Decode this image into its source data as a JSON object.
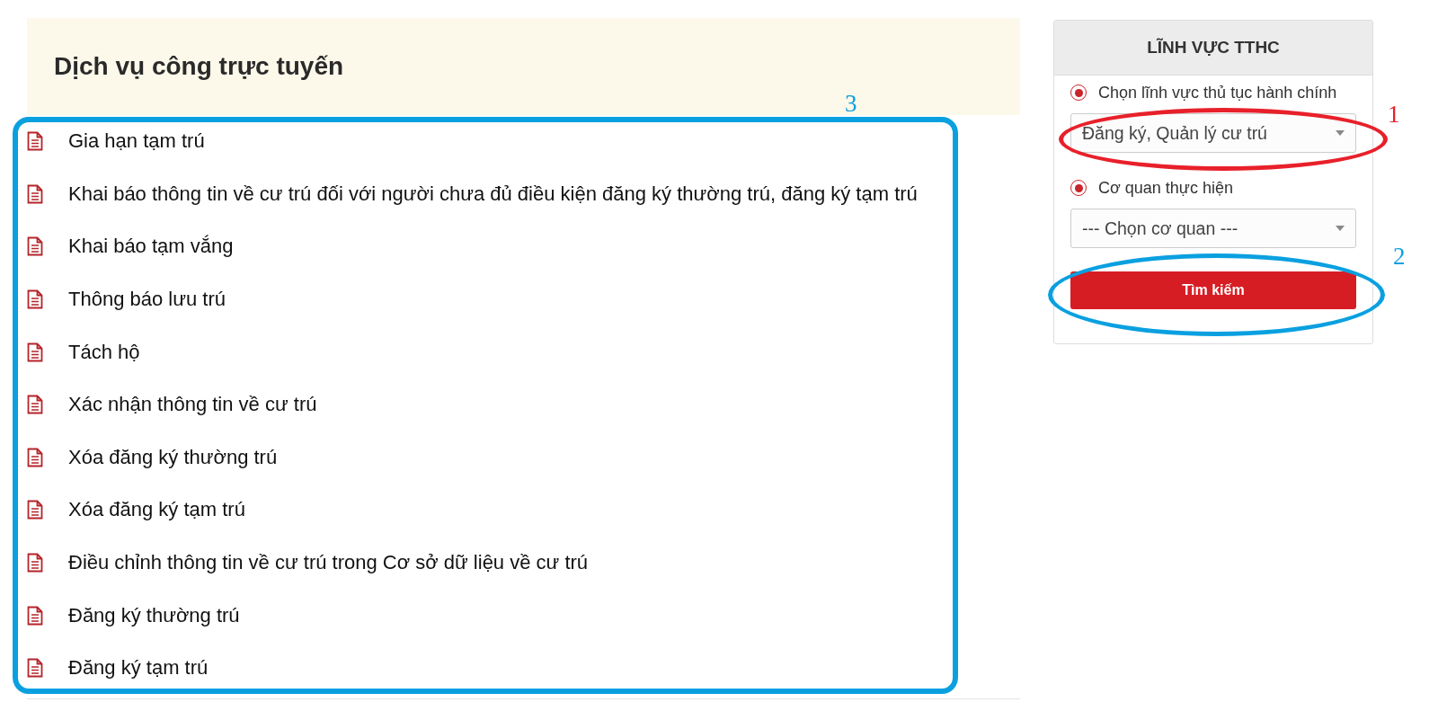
{
  "main": {
    "title": "Dịch vụ công trực tuyến",
    "services": [
      "Gia hạn tạm trú",
      "Khai báo thông tin về cư trú đối với người chưa đủ điều kiện đăng ký thường trú, đăng ký tạm trú",
      "Khai báo tạm vắng",
      "Thông báo lưu trú",
      "Tách hộ",
      "Xác nhận thông tin về cư trú",
      "Xóa đăng ký thường trú",
      "Xóa đăng ký tạm trú",
      "Điều chỉnh thông tin về cư trú trong Cơ sở dữ liệu về cư trú",
      "Đăng ký thường trú",
      "Đăng ký tạm trú"
    ]
  },
  "sidebar": {
    "title": "LĨNH VỰC TTHC",
    "filters": [
      {
        "label": "Chọn lĩnh vực thủ tục hành chính",
        "selected": true,
        "value": "Đăng ký, Quản lý cư trú"
      },
      {
        "label": "Cơ quan thực hiện",
        "selected": true,
        "value": "--- Chọn cơ quan ---"
      }
    ],
    "button": "Tìm kiếm"
  },
  "annotations": [
    {
      "label": "1",
      "color": "#e8202a",
      "kind": "ellipse"
    },
    {
      "label": "2",
      "color": "#0aa0e0",
      "kind": "ellipse"
    },
    {
      "label": "3",
      "color": "#0aa0e0",
      "kind": "rectangle"
    }
  ]
}
